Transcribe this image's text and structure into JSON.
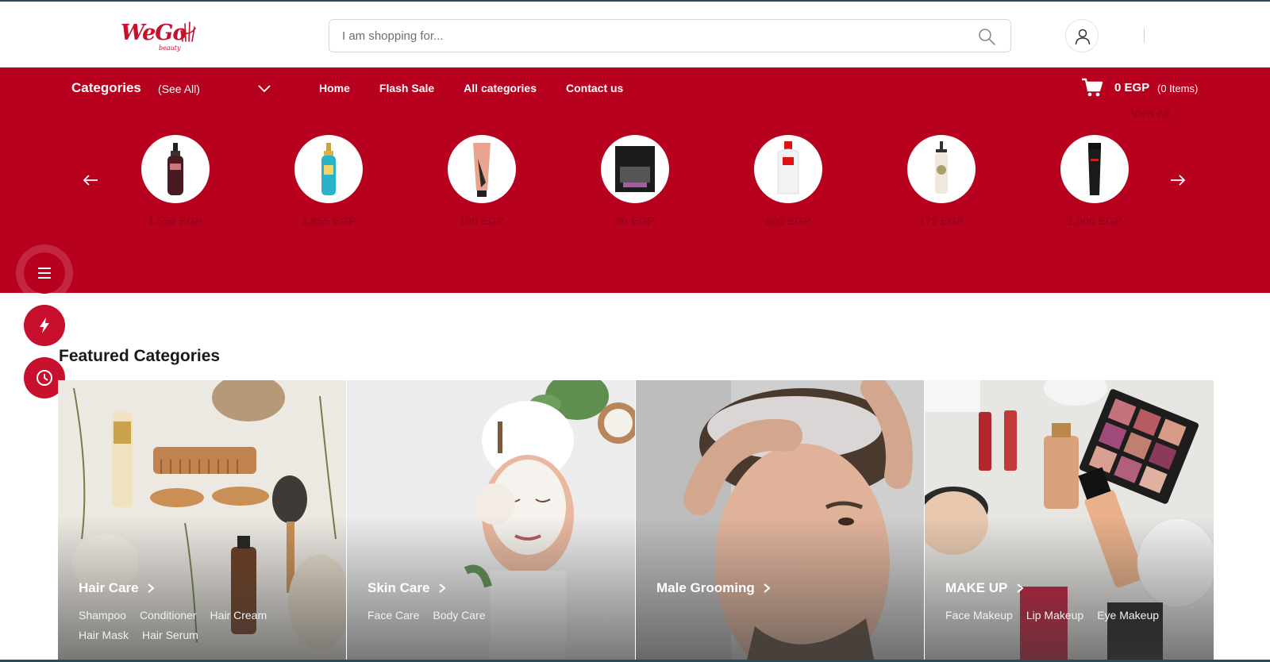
{
  "header": {
    "logo_text": "WeGo",
    "logo_sub": "beauty",
    "search_placeholder": "I am shopping for..."
  },
  "nav": {
    "categories_label": "Categories",
    "see_all_label": "(See All)",
    "links": [
      "Home",
      "Flash Sale",
      "All categories",
      "Contact us"
    ],
    "cart_total": "0 EGP",
    "cart_items": "(0 Items)",
    "view_all": "View All"
  },
  "products": [
    {
      "price": "1,550 EGP",
      "kind": "bottle-dark"
    },
    {
      "price": "1,855 EGP",
      "kind": "bottle-teal"
    },
    {
      "price": "100 EGP",
      "kind": "tube-pink"
    },
    {
      "price": "90 EGP",
      "kind": "sachet-black"
    },
    {
      "price": "660 EGP",
      "kind": "bottle-white"
    },
    {
      "price": "175 EGP",
      "kind": "pump-floral"
    },
    {
      "price": "1,000 EGP",
      "kind": "tube-black"
    }
  ],
  "featured": {
    "title": "Featured Categories",
    "categories": [
      {
        "name": "Hair Care",
        "subs": [
          "Shampoo",
          "Conditioner",
          "Hair Cream",
          "Hair Mask",
          "Hair Serum"
        ]
      },
      {
        "name": "Skin Care",
        "subs": [
          "Face Care",
          "Body Care"
        ]
      },
      {
        "name": "Male Grooming",
        "subs": []
      },
      {
        "name": "MAKE UP",
        "subs": [
          "Face Makeup",
          "Lip Makeup",
          "Eye Makeup"
        ]
      }
    ]
  },
  "colors": {
    "brand_red": "#b8001f",
    "price_red": "#9e001a",
    "fab_red": "#c8102e"
  },
  "icons": {
    "search": "search-icon",
    "account": "user-icon",
    "cart": "cart-icon",
    "menu": "hamburger-icon",
    "flash": "lightning-icon",
    "recent": "clock-icon"
  }
}
